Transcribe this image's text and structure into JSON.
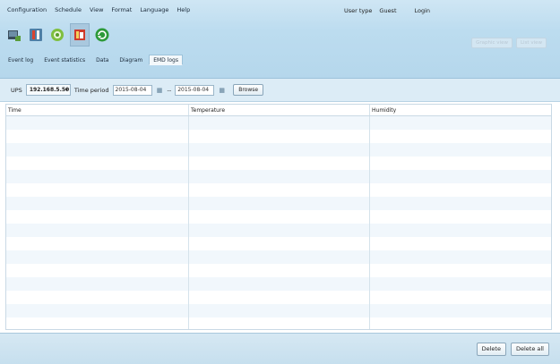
{
  "menu": {
    "items": [
      "Configuration",
      "Schedule",
      "View",
      "Format",
      "Language",
      "Help"
    ]
  },
  "user": {
    "type_label": "User type",
    "type_value": "Guest",
    "login_label": "Login"
  },
  "toolbar": {
    "icons": [
      "monitor-icon",
      "tools-icon",
      "gear-icon",
      "log-icon",
      "refresh-icon"
    ],
    "graphic_view_label": "Graphic view",
    "list_view_label": "List view"
  },
  "tabs": [
    "Event log",
    "Event statistics",
    "Data",
    "Diagram",
    "EMD logs"
  ],
  "active_tab": "EMD logs",
  "filter": {
    "ups_label": "UPS",
    "ups_value": "192.168.5.50",
    "time_period_label": "Time period",
    "start_date": "2015-08-04",
    "separator": "--",
    "end_date": "2015-08-04",
    "browse_label": "Browse"
  },
  "table": {
    "columns": [
      "Time",
      "Temperature",
      "Humidity"
    ],
    "rows": []
  },
  "footer": {
    "delete_label": "Delete",
    "delete_all_label": "Delete all"
  },
  "colors": {
    "band": "#bcdcef",
    "filter_bg": "#dcecf6",
    "row_alt": "#f1f7fc"
  }
}
